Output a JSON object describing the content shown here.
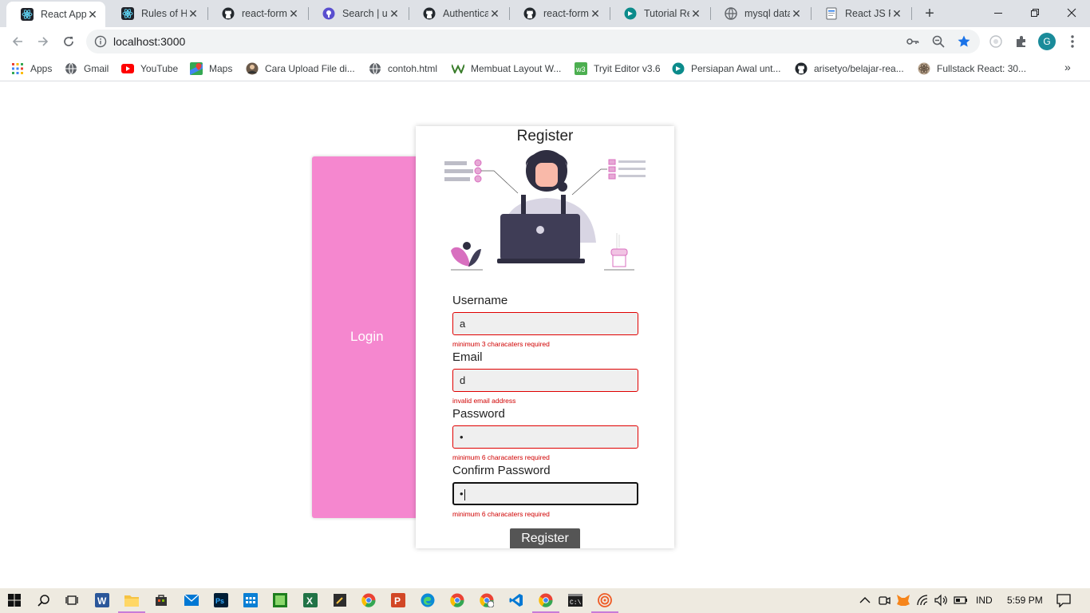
{
  "browser": {
    "tabs": [
      {
        "label": "React App",
        "icon": "react-icon",
        "active": true
      },
      {
        "label": "Rules of Ho",
        "icon": "react-icon"
      },
      {
        "label": "react-form-",
        "icon": "github-icon"
      },
      {
        "label": "Search | unf",
        "icon": "search-site-icon"
      },
      {
        "label": "Authenticat",
        "icon": "github-icon"
      },
      {
        "label": "react-form-",
        "icon": "github-icon"
      },
      {
        "label": "Tutorial Rea",
        "icon": "tutorial-icon"
      },
      {
        "label": "mysql datal",
        "icon": "globe-icon"
      },
      {
        "label": "React JS Pa",
        "icon": "doc-icon"
      }
    ],
    "url": "localhost:3000",
    "profile_initial": "G",
    "bookmarks": [
      {
        "label": "Apps",
        "icon": "apps-grid-icon"
      },
      {
        "label": "Gmail",
        "icon": "globe-icon"
      },
      {
        "label": "YouTube",
        "icon": "youtube-icon"
      },
      {
        "label": "Maps",
        "icon": "maps-icon"
      },
      {
        "label": "Cara Upload File di...",
        "icon": "avatar-icon"
      },
      {
        "label": "contoh.html",
        "icon": "globe-icon"
      },
      {
        "label": "Membuat Layout W...",
        "icon": "w-icon"
      },
      {
        "label": "Tryit Editor v3.6",
        "icon": "w3-icon"
      },
      {
        "label": "Persiapan Awal unt...",
        "icon": "tutorial-icon"
      },
      {
        "label": "arisetyo/belajar-rea...",
        "icon": "github-icon"
      },
      {
        "label": "Fullstack React: 30...",
        "icon": "react-icon"
      }
    ],
    "more_bookmarks": "»"
  },
  "page": {
    "login_label": "Login",
    "register_title": "Register",
    "fields": [
      {
        "label": "Username",
        "value": "a",
        "error": "minimum 3 characaters required"
      },
      {
        "label": "Email",
        "value": "d",
        "error": "invalid email address"
      },
      {
        "label": "Password",
        "value": "•",
        "error": "minimum 6 characaters required"
      },
      {
        "label": "Confirm Password",
        "value": "•",
        "error": "minimum 6 characaters required"
      }
    ],
    "register_button": "Register",
    "colors": {
      "login_panel": "#f587cf",
      "error": "#d00000",
      "button": "#555555",
      "illustration_accent": "#d86fbf"
    }
  },
  "taskbar": {
    "language": "IND",
    "time": "5:59 PM"
  }
}
